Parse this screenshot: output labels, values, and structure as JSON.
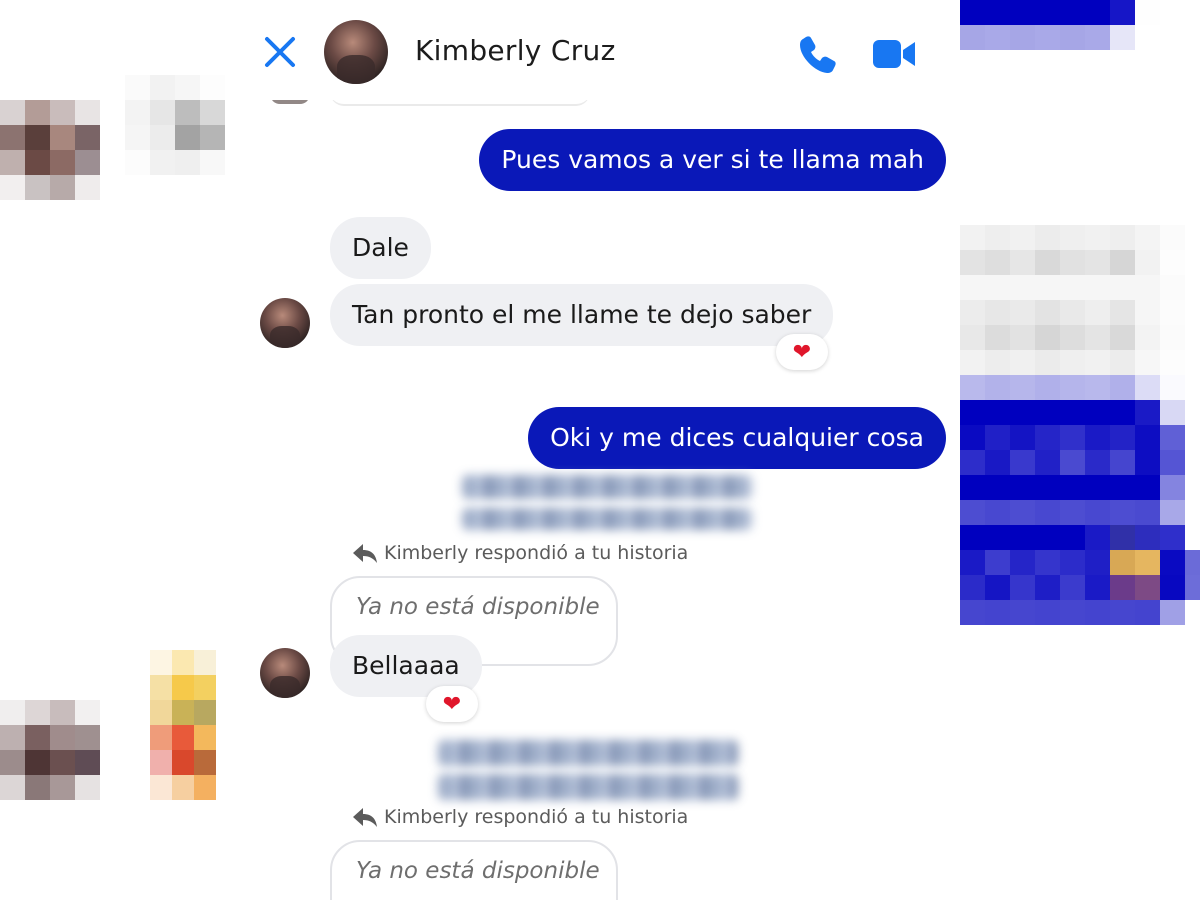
{
  "contact": {
    "name": "Kimberly Cruz"
  },
  "header": {
    "close_icon": "close-icon",
    "call_icon": "phone-icon",
    "video_icon": "video-camera-icon"
  },
  "messages": [
    {
      "sender": "me",
      "text": "Pues vamos a ver si te llama mah"
    },
    {
      "sender": "contact",
      "text": "Dale"
    },
    {
      "sender": "contact",
      "text": "Tan pronto el me llame te dejo saber",
      "reaction": "❤"
    },
    {
      "sender": "me",
      "text": "Oki y me dices cualquier cosa"
    },
    {
      "sender": "contact",
      "story_reply_note": "Kimberly respondió a tu historia",
      "story_status": "Ya no está disponible",
      "text": "Bellaaaa",
      "reaction": "❤"
    },
    {
      "sender": "contact",
      "story_reply_note": "Kimberly respondió a tu historia",
      "story_status": "Ya no está disponible"
    }
  ],
  "colors": {
    "outgoing_bubble": "#0a18b8",
    "incoming_bubble": "#eff0f3",
    "accent": "#1877f2",
    "reaction_heart": "#e0162b"
  }
}
